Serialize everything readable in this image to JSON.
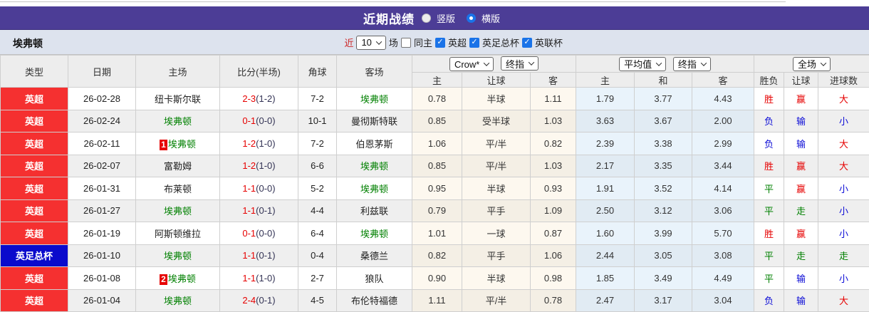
{
  "title_bar": {
    "title": "近期战绩",
    "radio_vertical": "竖版",
    "radio_vertical_selected": false,
    "radio_horizontal": "横版",
    "radio_horizontal_selected": true
  },
  "filter_bar": {
    "team": "埃弗顿",
    "near_label": "近",
    "count_select": "10",
    "games_label": "场",
    "same_home_label": "同主",
    "same_home_checked": false,
    "league_checkboxes": [
      {
        "label": "英超",
        "checked": true
      },
      {
        "label": "英足总杯",
        "checked": true
      },
      {
        "label": "英联杯",
        "checked": true
      }
    ]
  },
  "table": {
    "left_headers": [
      "类型",
      "日期",
      "主场",
      "比分(半场)",
      "角球",
      "客场"
    ],
    "group_headers": {
      "crow_select": "Crow*",
      "handicap_time_select": "终指",
      "avg_select": "平均值",
      "europe_time_select": "终指",
      "fulltime_select": "全场"
    },
    "sub_headers_handicap": [
      "主",
      "让球",
      "客"
    ],
    "sub_headers_europe": [
      "主",
      "和",
      "客"
    ],
    "sub_headers_result": [
      "胜负",
      "让球",
      "进球数"
    ],
    "rows": [
      {
        "type": "英超",
        "type_style": "league-red",
        "date": "26-02-28",
        "home": "纽卡斯尔联",
        "home_hl": false,
        "home_badge": "",
        "score": "2-3",
        "half": "(1-2)",
        "corner": "7-2",
        "away": "埃弗顿",
        "away_hl": true,
        "odds": [
          "0.78",
          "半球",
          "1.11",
          "1.79",
          "3.77",
          "4.43"
        ],
        "results": [
          [
            "胜",
            "r"
          ],
          [
            "赢",
            "r"
          ],
          [
            "大",
            "r"
          ]
        ]
      },
      {
        "type": "英超",
        "type_style": "league-red",
        "date": "26-02-24",
        "home": "埃弗顿",
        "home_hl": true,
        "home_badge": "",
        "score": "0-1",
        "half": "(0-0)",
        "corner": "10-1",
        "away": "曼彻斯特联",
        "away_hl": false,
        "odds": [
          "0.85",
          "受半球",
          "1.03",
          "3.63",
          "3.67",
          "2.00"
        ],
        "results": [
          [
            "负",
            "b"
          ],
          [
            "输",
            "b"
          ],
          [
            "小",
            "b"
          ]
        ]
      },
      {
        "type": "英超",
        "type_style": "league-red",
        "date": "26-02-11",
        "home": "埃弗顿",
        "home_hl": true,
        "home_badge": "1",
        "score": "1-2",
        "half": "(1-0)",
        "corner": "7-2",
        "away": "伯恩茅斯",
        "away_hl": false,
        "odds": [
          "1.06",
          "平/半",
          "0.82",
          "2.39",
          "3.38",
          "2.99"
        ],
        "results": [
          [
            "负",
            "b"
          ],
          [
            "输",
            "b"
          ],
          [
            "大",
            "r"
          ]
        ]
      },
      {
        "type": "英超",
        "type_style": "league-red",
        "date": "26-02-07",
        "home": "富勒姆",
        "home_hl": false,
        "home_badge": "",
        "score": "1-2",
        "half": "(1-0)",
        "corner": "6-6",
        "away": "埃弗顿",
        "away_hl": true,
        "odds": [
          "0.85",
          "平/半",
          "1.03",
          "2.17",
          "3.35",
          "3.44"
        ],
        "results": [
          [
            "胜",
            "r"
          ],
          [
            "赢",
            "r"
          ],
          [
            "大",
            "r"
          ]
        ]
      },
      {
        "type": "英超",
        "type_style": "league-red",
        "date": "26-01-31",
        "home": "布莱顿",
        "home_hl": false,
        "home_badge": "",
        "score": "1-1",
        "half": "(0-0)",
        "corner": "5-2",
        "away": "埃弗顿",
        "away_hl": true,
        "odds": [
          "0.95",
          "半球",
          "0.93",
          "1.91",
          "3.52",
          "4.14"
        ],
        "results": [
          [
            "平",
            "g"
          ],
          [
            "赢",
            "r"
          ],
          [
            "小",
            "b"
          ]
        ]
      },
      {
        "type": "英超",
        "type_style": "league-red",
        "date": "26-01-27",
        "home": "埃弗顿",
        "home_hl": true,
        "home_badge": "",
        "score": "1-1",
        "half": "(0-1)",
        "corner": "4-4",
        "away": "利兹联",
        "away_hl": false,
        "odds": [
          "0.79",
          "平手",
          "1.09",
          "2.50",
          "3.12",
          "3.06"
        ],
        "results": [
          [
            "平",
            "g"
          ],
          [
            "走",
            "g"
          ],
          [
            "小",
            "b"
          ]
        ]
      },
      {
        "type": "英超",
        "type_style": "league-red",
        "date": "26-01-19",
        "home": "阿斯顿维拉",
        "home_hl": false,
        "home_badge": "",
        "score": "0-1",
        "half": "(0-0)",
        "corner": "6-4",
        "away": "埃弗顿",
        "away_hl": true,
        "odds": [
          "1.01",
          "一球",
          "0.87",
          "1.60",
          "3.99",
          "5.70"
        ],
        "results": [
          [
            "胜",
            "r"
          ],
          [
            "赢",
            "r"
          ],
          [
            "小",
            "b"
          ]
        ]
      },
      {
        "type": "英足总杯",
        "type_style": "league-blue",
        "date": "26-01-10",
        "home": "埃弗顿",
        "home_hl": true,
        "home_badge": "",
        "score": "1-1",
        "half": "(0-1)",
        "corner": "0-4",
        "away": "桑德兰",
        "away_hl": false,
        "odds": [
          "0.82",
          "平手",
          "1.06",
          "2.44",
          "3.05",
          "3.08"
        ],
        "results": [
          [
            "平",
            "g"
          ],
          [
            "走",
            "g"
          ],
          [
            "走",
            "g"
          ]
        ]
      },
      {
        "type": "英超",
        "type_style": "league-red",
        "date": "26-01-08",
        "home": "埃弗顿",
        "home_hl": true,
        "home_badge": "2",
        "score": "1-1",
        "half": "(1-0)",
        "corner": "2-7",
        "away": "狼队",
        "away_hl": false,
        "odds": [
          "0.90",
          "半球",
          "0.98",
          "1.85",
          "3.49",
          "4.49"
        ],
        "results": [
          [
            "平",
            "g"
          ],
          [
            "输",
            "b"
          ],
          [
            "小",
            "b"
          ]
        ]
      },
      {
        "type": "英超",
        "type_style": "league-red",
        "date": "26-01-04",
        "home": "埃弗顿",
        "home_hl": true,
        "home_badge": "",
        "score": "2-4",
        "half": "(0-1)",
        "corner": "4-5",
        "away": "布伦特福德",
        "away_hl": false,
        "odds": [
          "1.11",
          "平/半",
          "0.78",
          "2.47",
          "3.17",
          "3.04"
        ],
        "results": [
          [
            "负",
            "b"
          ],
          [
            "输",
            "b"
          ],
          [
            "大",
            "r"
          ]
        ]
      }
    ]
  },
  "colors": {
    "titlebar_purple": "#4c3d96",
    "league_red": "#f53030",
    "league_blue": "#0a0acc",
    "win_red": "#e60000",
    "draw_green": "#008000",
    "lose_blue": "#0b0bd6",
    "team_highlight_green": "#008000",
    "filterbar_bg": "#dde3ee",
    "handicap_col_bg": "#fdf8ef",
    "europe_col_bg": "#e9f3fb",
    "checkbox_blue": "#1a73e8"
  }
}
